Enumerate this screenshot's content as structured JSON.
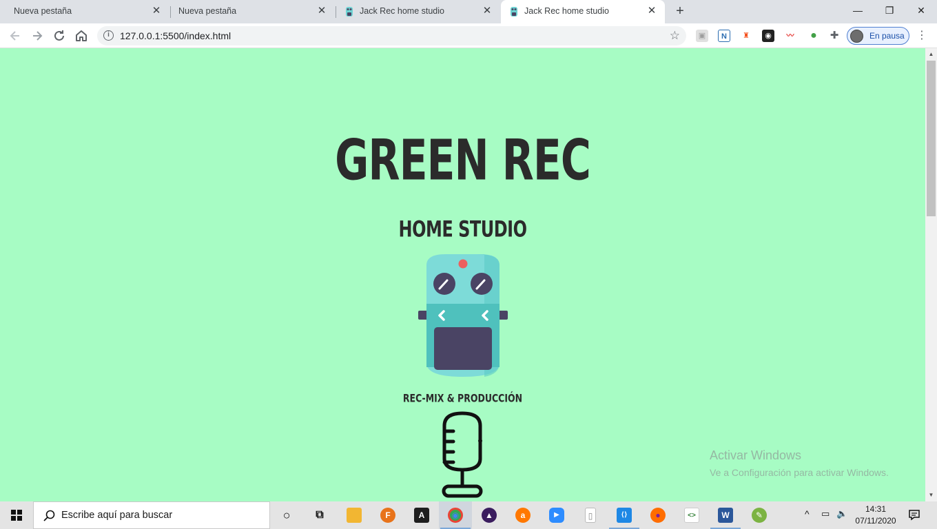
{
  "tabs": [
    {
      "title": "Nueva pestaña",
      "has_favicon": false,
      "active": false
    },
    {
      "title": "Nueva pestaña",
      "has_favicon": false,
      "active": false
    },
    {
      "title": "Jack Rec home studio",
      "has_favicon": true,
      "active": false
    },
    {
      "title": "Jack Rec home studio",
      "has_favicon": true,
      "active": true
    }
  ],
  "tab_close_glyph": "✕",
  "new_tab_glyph": "+",
  "window_controls": {
    "minimize": "—",
    "restore": "❐",
    "close": "✕"
  },
  "toolbar": {
    "url": "127.0.0.1:5500/index.html",
    "info_glyph": "i",
    "star_glyph": "☆",
    "profile_label": "En pausa",
    "extensions": [
      {
        "name": "extension-shield-icon",
        "color": "#9e9e9e",
        "glyph": "▣"
      },
      {
        "name": "extension-n-icon",
        "color": "#2b6cb0",
        "glyph": "N"
      },
      {
        "name": "extension-lighthouse-icon",
        "color": "#f4511e",
        "glyph": "♜"
      },
      {
        "name": "extension-camera-icon",
        "color": "#212121",
        "glyph": "◉"
      },
      {
        "name": "extension-chart-icon",
        "color": "#e53935",
        "glyph": "〰"
      },
      {
        "name": "extension-colorzilla-icon",
        "color": "#43a047",
        "glyph": "●"
      },
      {
        "name": "extensions-puzzle-icon",
        "color": "#5f6368",
        "glyph": "✚"
      }
    ],
    "menu_glyph": "⋮"
  },
  "page": {
    "background": "#a7fcc4",
    "title": "GREEN REC",
    "subtitle": "HOME STUDIO",
    "tagline": "REC-MIX & PRODUCCIÓN"
  },
  "watermark": {
    "line1": "Activar Windows",
    "line2": "Ve a Configuración para activar Windows."
  },
  "taskbar": {
    "search_placeholder": "Escribe aquí para buscar",
    "apps": [
      {
        "name": "cortana-icon",
        "glyph": "○",
        "color": "transparent",
        "fg": "#111",
        "active": false
      },
      {
        "name": "task-view-icon",
        "glyph": "⧉",
        "color": "transparent",
        "fg": "#111",
        "active": false
      },
      {
        "name": "file-explorer-icon",
        "glyph": "▬",
        "color": "#f2b632",
        "fg": "#fff",
        "active": false
      },
      {
        "name": "fl-studio-icon",
        "glyph": "F",
        "color": "#e8731a",
        "fg": "#fff",
        "active": false
      },
      {
        "name": "pro-tools-icon",
        "glyph": "A",
        "color": "#1e1e1e",
        "fg": "#fff",
        "active": false
      },
      {
        "name": "chrome-icon",
        "glyph": "◉",
        "color": "#34a853",
        "fg": "#fff",
        "active": true
      },
      {
        "name": "avid-icon",
        "glyph": "▲",
        "color": "#3b1d5e",
        "fg": "#fff",
        "active": false
      },
      {
        "name": "avast-icon",
        "glyph": "a",
        "color": "#ff7800",
        "fg": "#fff",
        "active": false
      },
      {
        "name": "zoom-icon",
        "glyph": "▶",
        "color": "#2d8cff",
        "fg": "#fff",
        "active": false
      },
      {
        "name": "document-icon",
        "glyph": "▯",
        "color": "#ffffff",
        "fg": "#666",
        "active": false
      },
      {
        "name": "vscode-icon",
        "glyph": "⟨⟩",
        "color": "#1e88e5",
        "fg": "#fff",
        "active": true
      },
      {
        "name": "firefox-icon",
        "glyph": "●",
        "color": "#ff6d00",
        "fg": "#fff",
        "active": false
      },
      {
        "name": "code-editor-icon",
        "glyph": "<>",
        "color": "#ffffff",
        "fg": "#2e7d32",
        "active": false
      },
      {
        "name": "word-icon",
        "glyph": "W",
        "color": "#2b579a",
        "fg": "#fff",
        "active": true
      },
      {
        "name": "paint-icon",
        "glyph": "✎",
        "color": "#7cb342",
        "fg": "#fff",
        "active": false
      }
    ],
    "tray": {
      "chevron": "^",
      "network": "▭",
      "volume": "🔈",
      "time": "14:31",
      "date": "07/11/2020"
    }
  }
}
